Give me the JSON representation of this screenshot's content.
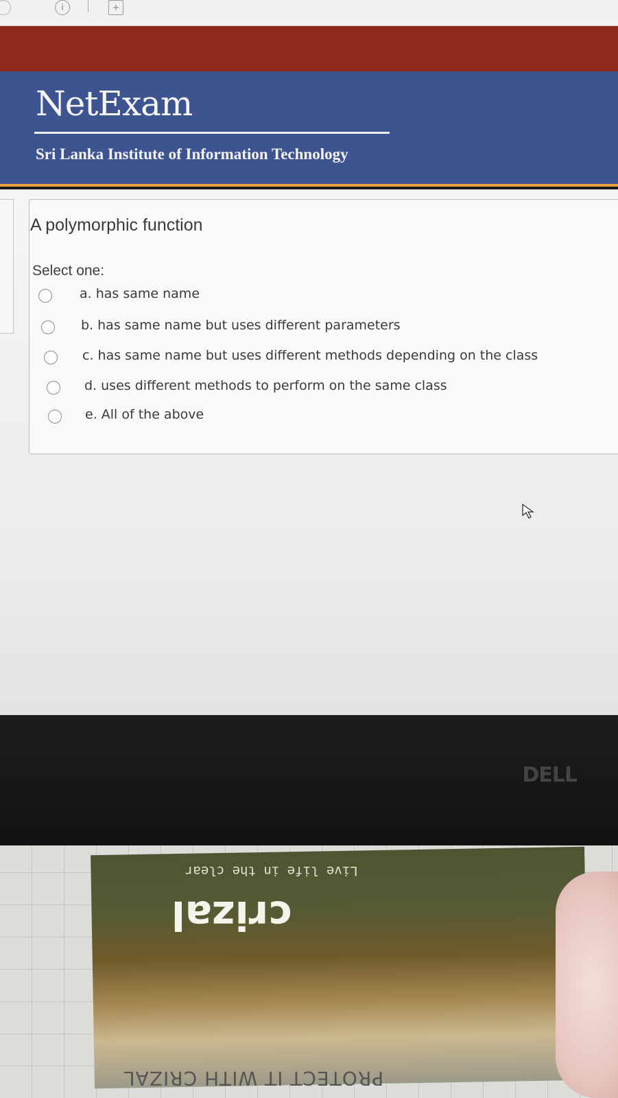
{
  "browser": {
    "info_glyph": "i",
    "new_tab_glyph": "+"
  },
  "header": {
    "logo_title": "NetExam",
    "institution": "Sri Lanka Institute of Information Technology"
  },
  "question": {
    "text": "A polymorphic function",
    "prompt": "Select one:",
    "options": [
      {
        "label": "a. has same name"
      },
      {
        "label": "b. has same name but uses different parameters"
      },
      {
        "label": "c. has same name but uses different methods depending on the class"
      },
      {
        "label": "d. uses different methods to perform on the same class"
      },
      {
        "label": "e. All of the above"
      }
    ]
  },
  "monitor": {
    "brand": "DELL"
  },
  "cloth": {
    "tagline": "Live life in the clear",
    "brand": "crizal",
    "footer": "PROTECT IT WITH CRIZAL"
  },
  "colors": {
    "header_blue": "#3d5490",
    "brand_red": "#8e2a1d",
    "accent_orange": "#e8a33a"
  }
}
